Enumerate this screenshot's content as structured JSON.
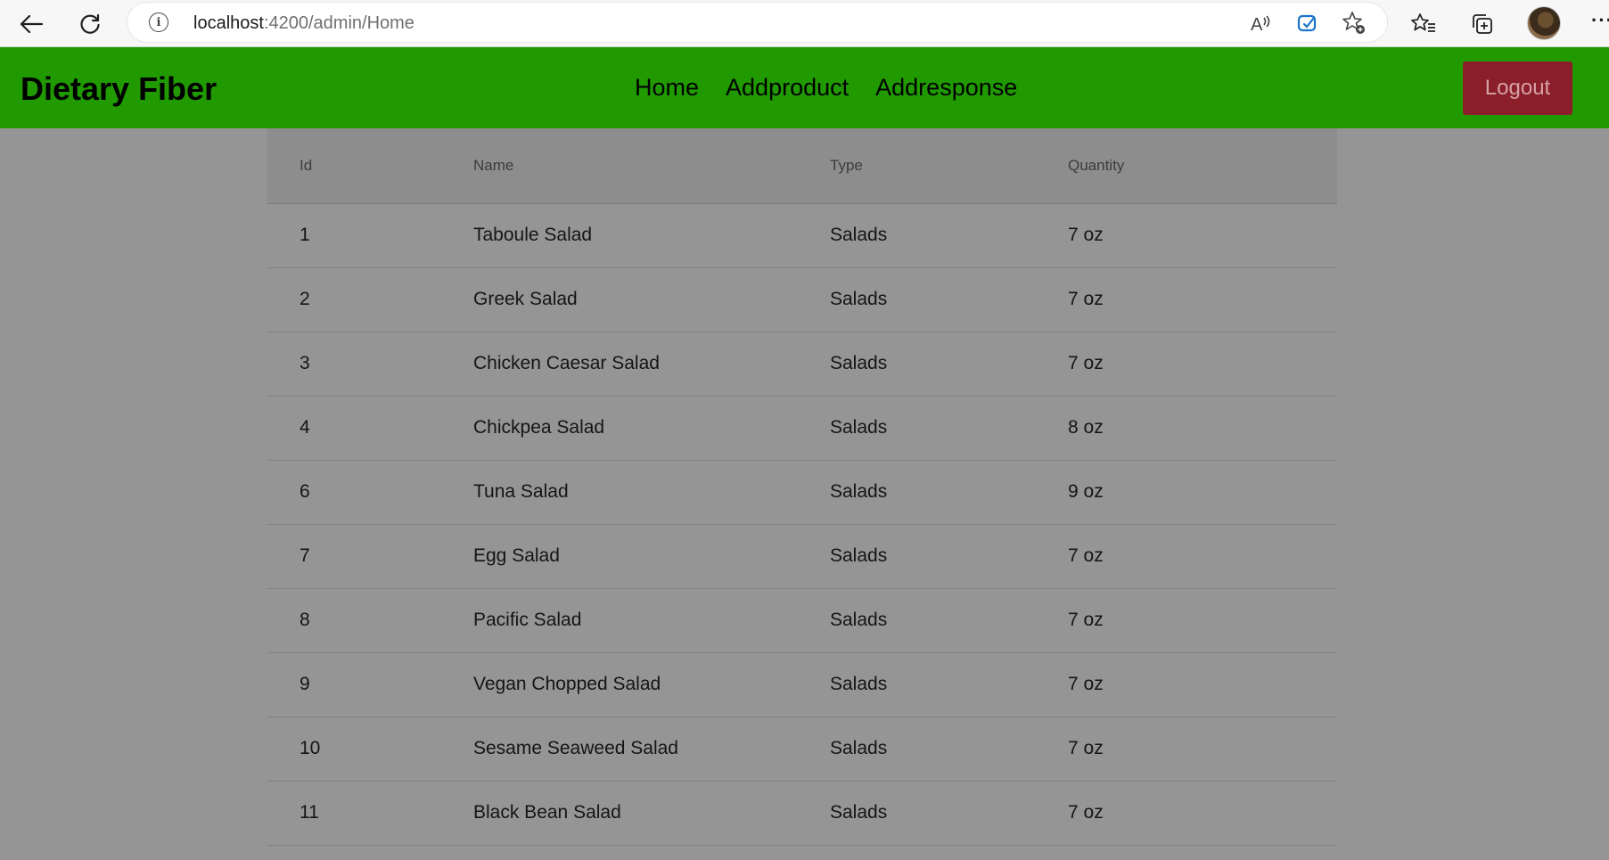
{
  "browser": {
    "url_host": "localhost",
    "url_path": ":4200/admin/Home",
    "icons": {
      "back": "back-arrow-icon",
      "refresh": "refresh-icon",
      "info": "site-info-icon",
      "read_aloud": "read-aloud-icon",
      "copilot": "copilot-icon",
      "add_favorite": "add-favorite-icon",
      "favorites": "favorites-icon",
      "collections": "collections-icon",
      "profile": "profile-avatar",
      "more": "more-icon"
    }
  },
  "navbar": {
    "brand": "Dietary Fiber",
    "links": [
      "Home",
      "Addproduct",
      "Addresponse"
    ],
    "logout_label": "Logout",
    "colors": {
      "background": "#209a00",
      "logout_bg": "#8a1f2a",
      "logout_text": "#d7a2a6"
    }
  },
  "table": {
    "headers": [
      "Id",
      "Name",
      "Type",
      "Quantity"
    ],
    "rows": [
      [
        "1",
        "Taboule Salad",
        "Salads",
        "7 oz"
      ],
      [
        "2",
        "Greek Salad",
        "Salads",
        "7 oz"
      ],
      [
        "3",
        "Chicken Caesar Salad",
        "Salads",
        "7 oz"
      ],
      [
        "4",
        "Chickpea Salad",
        "Salads",
        "8 oz"
      ],
      [
        "6",
        "Tuna Salad",
        "Salads",
        "9 oz"
      ],
      [
        "7",
        "Egg Salad",
        "Salads",
        "7 oz"
      ],
      [
        "8",
        "Pacific Salad",
        "Salads",
        "7 oz"
      ],
      [
        "9",
        "Vegan Chopped Salad",
        "Salads",
        "7 oz"
      ],
      [
        "10",
        "Sesame Seaweed Salad",
        "Salads",
        "7 oz"
      ],
      [
        "11",
        "Black Bean Salad",
        "Salads",
        "7 oz"
      ]
    ]
  }
}
